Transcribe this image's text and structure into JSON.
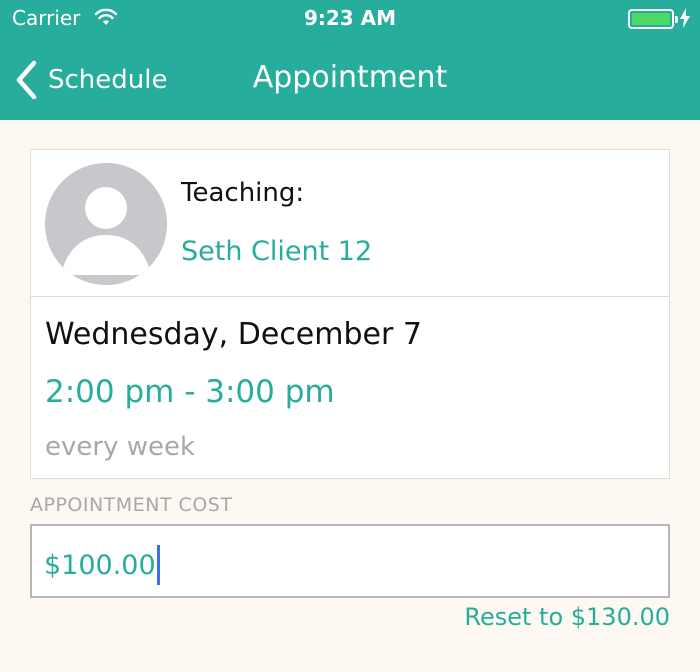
{
  "status_bar": {
    "carrier": "Carrier",
    "time": "9:23 AM",
    "battery_level": 1.0
  },
  "nav": {
    "back_label": "Schedule",
    "title": "Appointment"
  },
  "teaching": {
    "label": "Teaching:",
    "client_name": "Seth Client 12"
  },
  "schedule": {
    "date": "Wednesday, December 7",
    "time_range": "2:00 pm - 3:00 pm",
    "recurrence": "every week"
  },
  "cost": {
    "label": "APPOINTMENT COST",
    "value": "$100.00",
    "reset_label": "Reset to $130.00"
  },
  "colors": {
    "accent": "#27ad9b",
    "background": "#fdf9f2",
    "muted_text": "#a8a8a8",
    "caret": "#3b6ef0",
    "battery": "#4cd964"
  },
  "icons": {
    "back": "chevron-left-icon",
    "wifi": "wifi-icon",
    "battery": "battery-icon",
    "charging": "bolt-icon",
    "avatar": "person-placeholder-icon"
  }
}
